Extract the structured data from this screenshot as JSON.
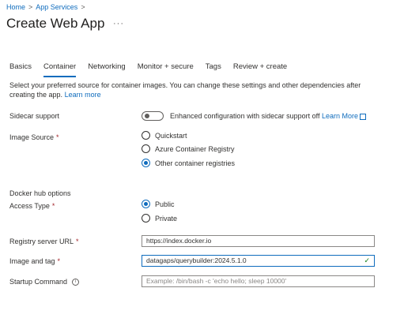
{
  "breadcrumb": {
    "home": "Home",
    "sep1": ">",
    "app_services": "App Services",
    "sep2": ">"
  },
  "page": {
    "title": "Create Web App",
    "more": "···"
  },
  "tabs": [
    {
      "label": "Basics"
    },
    {
      "label": "Container"
    },
    {
      "label": "Networking"
    },
    {
      "label": "Monitor + secure"
    },
    {
      "label": "Tags"
    },
    {
      "label": "Review + create"
    }
  ],
  "description": {
    "text": "Select your preferred source for container images. You can change these settings and other dependencies after creating the app.",
    "link": "Learn more"
  },
  "sidecar": {
    "label": "Sidecar support",
    "text": "Enhanced configuration with sidecar support off",
    "link": "Learn More",
    "state": "off"
  },
  "image_source": {
    "label": "Image Source",
    "required": "*",
    "options": [
      "Quickstart",
      "Azure Container Registry",
      "Other container registries"
    ],
    "selected": "Other container registries"
  },
  "docker_hub": {
    "section_title": "Docker hub options"
  },
  "access_type": {
    "label": "Access Type",
    "required": "*",
    "options": [
      "Public",
      "Private"
    ],
    "selected": "Public"
  },
  "registry_url": {
    "label": "Registry server URL",
    "required": "*",
    "value": "https://index.docker.io"
  },
  "image_tag": {
    "label": "Image and tag",
    "required": "*",
    "value": "datagaps/querybuilder:2024.5.1.0"
  },
  "startup_command": {
    "label": "Startup Command",
    "placeholder": "Example: /bin/bash -c 'echo hello; sleep 10000'",
    "value": ""
  },
  "icons": {
    "info": "info-icon",
    "external": "external-link-icon",
    "check": "checkmark-icon",
    "more": "more-icon"
  },
  "colors": {
    "accent": "#0f6cbd",
    "required": "#a4262c",
    "valid": "#107c10"
  }
}
